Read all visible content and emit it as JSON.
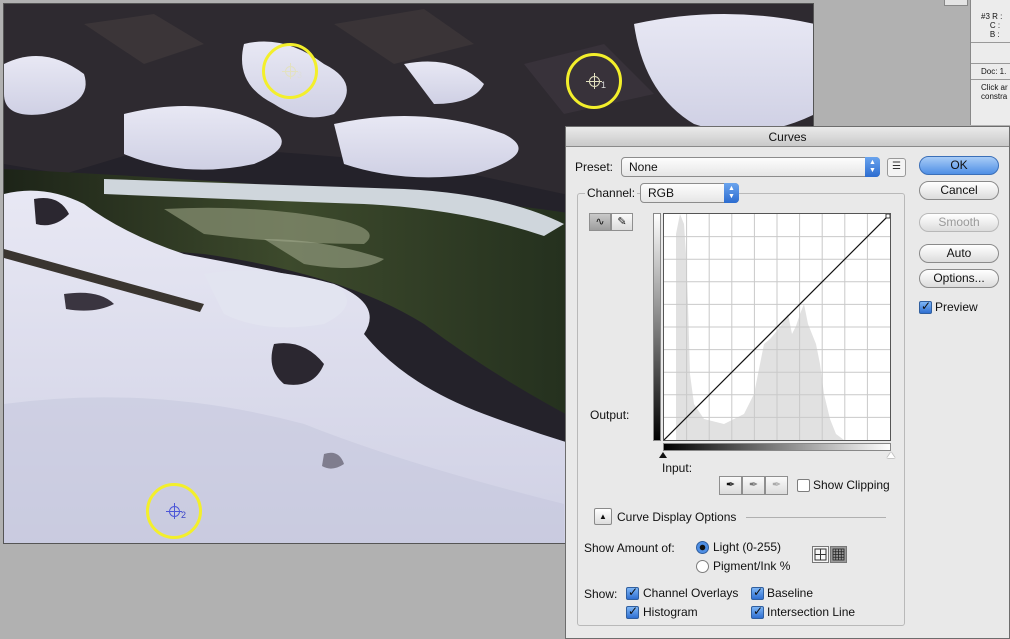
{
  "info_panel": {
    "sample_label": "#3",
    "rows": [
      "R :",
      "C :",
      "B :"
    ],
    "doc": "Doc: 1.",
    "hint_1": "Click ar",
    "hint_2": "constra"
  },
  "samplers": [
    {
      "num": "3",
      "color": "yellow"
    },
    {
      "num": "1",
      "color": "yellow"
    },
    {
      "num": "2",
      "color": "blue"
    }
  ],
  "dialog": {
    "title": "Curves",
    "preset_label": "Preset:",
    "preset_value": "None",
    "channel_label": "Channel:",
    "channel_value": "RGB",
    "output_label": "Output:",
    "input_label": "Input:",
    "show_clipping": "Show Clipping",
    "curve_display_options": "Curve Display Options",
    "show_amount_label": "Show Amount of:",
    "light_label": "Light  (0-255)",
    "pigment_label": "Pigment/Ink %",
    "show_label": "Show:",
    "channel_overlays": "Channel Overlays",
    "baseline": "Baseline",
    "histogram": "Histogram",
    "intersection_line": "Intersection Line",
    "buttons": {
      "ok": "OK",
      "cancel": "Cancel",
      "smooth": "Smooth",
      "auto": "Auto",
      "options": "Options..."
    },
    "preview_label": "Preview",
    "checks": {
      "preview": true,
      "show_clipping": false,
      "channel_overlays": true,
      "baseline": true,
      "histogram": true,
      "intersection_line": true
    },
    "show_amount": "light",
    "accent": "#4f8fe5"
  }
}
